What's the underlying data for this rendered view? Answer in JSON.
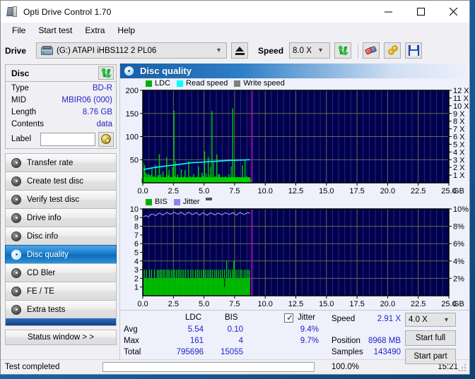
{
  "window": {
    "title": "Opti Drive Control 1.70",
    "app_icon": "disc-drive-icon",
    "minimize": "—",
    "maximize": "□",
    "close": "✕"
  },
  "menu": {
    "items": [
      "File",
      "Start test",
      "Extra",
      "Help"
    ]
  },
  "toolbar": {
    "drive_label": "Drive",
    "drive_value": "(G:)  ATAPI iHBS112  2 PL06",
    "eject_title": "Eject",
    "speed_label": "Speed",
    "speed_value": "8.0 X",
    "refresh_title": "Refresh",
    "erase_title": "Erase",
    "key_title": "Key",
    "save_title": "Save"
  },
  "disc": {
    "header": "Disc",
    "refresh_title": "Refresh disc",
    "rows": [
      {
        "key": "Type",
        "value": "BD-R"
      },
      {
        "key": "MID",
        "value": "MBIR06 (000)"
      },
      {
        "key": "Length",
        "value": "8.76 GB"
      },
      {
        "key": "Contents",
        "value": "data"
      }
    ],
    "label_key": "Label",
    "label_value": "",
    "label_placeholder": "",
    "label_button_title": "Disc label"
  },
  "nav": {
    "items": [
      {
        "label": "Transfer rate",
        "selected": false
      },
      {
        "label": "Create test disc",
        "selected": false
      },
      {
        "label": "Verify test disc",
        "selected": false
      },
      {
        "label": "Drive info",
        "selected": false
      },
      {
        "label": "Disc info",
        "selected": false
      },
      {
        "label": "Disc quality",
        "selected": true
      },
      {
        "label": "CD Bler",
        "selected": false
      },
      {
        "label": "FE / TE",
        "selected": false
      },
      {
        "label": "Extra tests",
        "selected": false
      }
    ],
    "status_window": "Status window > >"
  },
  "panel": {
    "title": "Disc quality",
    "icon": "disc-quality-icon"
  },
  "chart_data": [
    {
      "id": "ldc",
      "type": "line",
      "title": "LDC / Read speed",
      "legend": [
        {
          "label": "LDC",
          "color": "#00b000"
        },
        {
          "label": "Read speed",
          "color": "#00ffff"
        },
        {
          "label": "Write speed",
          "color": "#808080"
        }
      ],
      "legend_position": "top-left",
      "xlabel": "GB",
      "xlim": [
        0,
        25
      ],
      "xticks": [
        0.0,
        2.5,
        5.0,
        7.5,
        10.0,
        12.5,
        15.0,
        17.5,
        20.0,
        22.5,
        25.0
      ],
      "xticklabels": [
        "0.0",
        "2.5",
        "5.0",
        "7.5",
        "10.0",
        "12.5",
        "15.0",
        "17.5",
        "20.0",
        "22.5",
        "25.0"
      ],
      "ylabel_left": "LDC",
      "ylim_left": [
        0,
        200
      ],
      "yticks_left": [
        50,
        100,
        150,
        200
      ],
      "ylabel_right": "Speed",
      "ylim_right": [
        0,
        12
      ],
      "yticks_right": [
        1,
        2,
        3,
        4,
        5,
        6,
        7,
        8,
        9,
        10,
        11,
        12
      ],
      "yticklabels_right": [
        "1 X",
        "2 X",
        "3 X",
        "4 X",
        "5 X",
        "6 X",
        "7 X",
        "8 X",
        "9 X",
        "10 X",
        "11 X",
        "12 X"
      ],
      "grid": true,
      "background": "#000050",
      "data_end_gb": 8.76,
      "marker_gb": 8.9,
      "marker_color": "#c000c0",
      "series": [
        {
          "name": "LDC",
          "color": "#00d000",
          "style": "bars",
          "x": [
            0.05,
            0.15,
            0.25,
            0.35,
            0.45,
            0.55,
            0.65,
            0.75,
            0.85,
            0.95,
            1.05,
            1.15,
            1.25,
            1.35,
            1.45,
            1.55,
            1.65,
            1.75,
            1.85,
            1.95,
            2.05,
            2.15,
            2.25,
            2.35,
            2.45,
            2.55,
            2.65,
            2.75,
            2.85,
            2.95,
            3.05,
            3.15,
            3.25,
            3.35,
            3.45,
            3.55,
            3.65,
            3.75,
            3.85,
            3.95,
            4.05,
            4.15,
            4.25,
            4.35,
            4.45,
            4.55,
            4.65,
            4.75,
            4.85,
            4.95,
            5.05,
            5.15,
            5.25,
            5.35,
            5.45,
            5.55,
            5.65,
            5.75,
            5.85,
            5.95,
            6.05,
            6.15,
            6.25,
            6.35,
            6.45,
            6.55,
            6.65,
            6.75,
            6.85,
            6.95,
            7.05,
            7.15,
            7.25,
            7.35,
            7.45,
            7.55,
            7.65,
            7.75,
            7.85,
            7.95,
            8.05,
            8.15,
            8.25,
            8.35,
            8.45,
            8.55,
            8.65,
            8.75
          ],
          "values": [
            44,
            38,
            22,
            18,
            20,
            16,
            17,
            30,
            14,
            13,
            38,
            11,
            17,
            62,
            14,
            11,
            25,
            10,
            12,
            55,
            14,
            28,
            13,
            11,
            12,
            156,
            14,
            12,
            18,
            11,
            12,
            29,
            10,
            13,
            27,
            11,
            12,
            47,
            11,
            10,
            13,
            19,
            10,
            12,
            13,
            36,
            11,
            10,
            22,
            12,
            68,
            13,
            11,
            56,
            10,
            12,
            155,
            11,
            12,
            14,
            61,
            10,
            19,
            12,
            11,
            13,
            10,
            14,
            11,
            12,
            18,
            10,
            13,
            161,
            11,
            12,
            10,
            13,
            11,
            10,
            12,
            38,
            11,
            50,
            13,
            10,
            12,
            11
          ],
          "baseline_fill_max": 12
        },
        {
          "name": "Read speed",
          "color": "#00ffff",
          "style": "line",
          "x": [
            0.0,
            0.5,
            1.0,
            1.5,
            2.0,
            2.5,
            3.0,
            3.5,
            4.0,
            4.5,
            5.0,
            5.5,
            6.0,
            6.5,
            7.0,
            7.5,
            8.0,
            8.5,
            8.76
          ],
          "values_x_speed": [
            1.7,
            1.85,
            2.0,
            2.1,
            2.2,
            2.3,
            2.4,
            2.5,
            2.6,
            2.65,
            2.7,
            2.75,
            2.8,
            2.85,
            2.9,
            2.92,
            2.95,
            2.98,
            3.0
          ]
        },
        {
          "name": "Write speed",
          "color": "#808080",
          "style": "line",
          "x": [],
          "values": []
        }
      ]
    },
    {
      "id": "bis",
      "type": "line",
      "title": "BIS / Jitter",
      "legend": [
        {
          "label": "BIS",
          "color": "#00b000"
        },
        {
          "label": "Jitter",
          "color": "#8888e8"
        }
      ],
      "legend_position": "top-left",
      "xlabel": "GB",
      "xlim": [
        0,
        25
      ],
      "xticks": [
        0.0,
        2.5,
        5.0,
        7.5,
        10.0,
        12.5,
        15.0,
        17.5,
        20.0,
        22.5,
        25.0
      ],
      "xticklabels": [
        "0.0",
        "2.5",
        "5.0",
        "7.5",
        "10.0",
        "12.5",
        "15.0",
        "17.5",
        "20.0",
        "22.5",
        "25.0"
      ],
      "ylabel_left": "BIS",
      "ylim_left": [
        0,
        10
      ],
      "yticks_left": [
        1,
        2,
        3,
        4,
        5,
        6,
        7,
        8,
        9,
        10
      ],
      "ylabel_right": "Jitter",
      "ylim_right": [
        0,
        10
      ],
      "yticks_right": [
        2,
        4,
        6,
        8,
        10
      ],
      "yticklabels_right": [
        "2%",
        "4%",
        "6%",
        "8%",
        "10%"
      ],
      "grid": true,
      "background": "#000050",
      "data_end_gb": 8.76,
      "marker_gb": 8.9,
      "marker_color": "#c000c0",
      "series": [
        {
          "name": "BIS",
          "color": "#00d000",
          "style": "bars",
          "baseline_value": 2,
          "spike_positions_gb": [
            0.12,
            0.3,
            0.55,
            0.72,
            0.95,
            1.18,
            1.3,
            1.42,
            1.55,
            1.68,
            1.8,
            1.95,
            2.08,
            2.2,
            2.35,
            2.48,
            2.6,
            2.75,
            2.9,
            3.05,
            3.2,
            3.35,
            3.5,
            3.7,
            3.92,
            4.1,
            4.3,
            4.45,
            4.6,
            4.78,
            4.95,
            5.1,
            5.25,
            5.4,
            5.55,
            5.7,
            5.88,
            6.02,
            6.18,
            6.35,
            6.5,
            6.68,
            6.85,
            7.0,
            7.15,
            7.32,
            7.48,
            7.62,
            7.78,
            7.95,
            8.1,
            8.28,
            8.42,
            8.58,
            8.7
          ],
          "spike_values": [
            3,
            3,
            3,
            3,
            3,
            3,
            3,
            3,
            3,
            3,
            3,
            3,
            3,
            3,
            3,
            3,
            3,
            3,
            3,
            3,
            3,
            3,
            3,
            3,
            3,
            3,
            3,
            3,
            3,
            3,
            3,
            3,
            3,
            3,
            3,
            3,
            3,
            3,
            3,
            3,
            3,
            3,
            4,
            3,
            3,
            3,
            3,
            3,
            3,
            3,
            3,
            3,
            3,
            3,
            3
          ],
          "max_spike_gb": 7.45,
          "max_spike_value": 4
        },
        {
          "name": "Jitter",
          "color": "#9090f0",
          "style": "line",
          "x": [
            0.0,
            0.3,
            0.6,
            0.9,
            1.2,
            1.5,
            1.8,
            2.1,
            2.4,
            2.7,
            3.0,
            3.3,
            3.6,
            3.9,
            4.2,
            4.5,
            4.8,
            5.1,
            5.4,
            5.7,
            6.0,
            6.3,
            6.6,
            6.9,
            7.2,
            7.5,
            7.8,
            8.1,
            8.4,
            8.76
          ],
          "values_pct": [
            9.05,
            9.2,
            9.3,
            9.35,
            9.4,
            9.42,
            9.45,
            9.5,
            9.48,
            9.52,
            9.5,
            9.45,
            9.5,
            9.48,
            9.45,
            9.42,
            9.45,
            9.4,
            9.42,
            9.45,
            9.4,
            9.45,
            9.42,
            9.48,
            9.45,
            9.42,
            9.45,
            9.48,
            9.45,
            9.5
          ]
        }
      ]
    }
  ],
  "stats": {
    "col_headers": {
      "ldc": "LDC",
      "bis": "BIS",
      "jitter": "Jitter"
    },
    "row_labels": {
      "avg": "Avg",
      "max": "Max",
      "total": "Total"
    },
    "ldc": {
      "avg": "5.54",
      "max": "161",
      "total": "795696"
    },
    "bis": {
      "avg": "0.10",
      "max": "4",
      "total": "15055"
    },
    "jitter": {
      "avg": "9.4%",
      "max": "9.7%",
      "checked": true
    },
    "speed_label": "Speed",
    "speed_value": "2.91 X",
    "position_label": "Position",
    "position_value": "8968 MB",
    "samples_label": "Samples",
    "samples_value": "143490",
    "speed_select": "4.0 X",
    "start_full": "Start full",
    "start_part": "Start part"
  },
  "statusbar": {
    "message": "Test completed",
    "progress_percent": 100.0,
    "progress_text": "100.0%",
    "time": "15:21"
  },
  "colors": {
    "accent_blue": "#1560a8",
    "plot_bg": "#000050",
    "ldc_green": "#00d000",
    "read_speed_cyan": "#00ffff",
    "jitter_violet": "#9090f0",
    "marker_magenta": "#c000c0",
    "value_text": "#2222cc",
    "progress_green": "#0ea40e"
  }
}
